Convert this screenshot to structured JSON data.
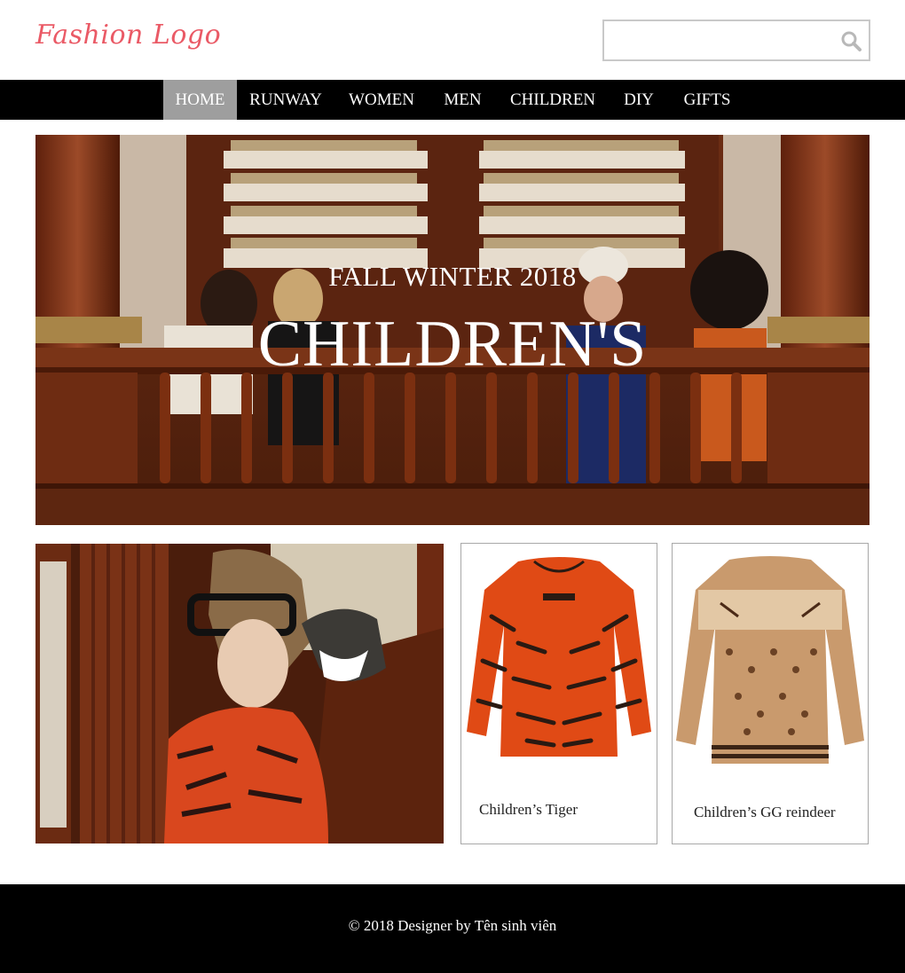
{
  "header": {
    "logo_text": "Fashion Logo",
    "search": {
      "placeholder": "",
      "value": "",
      "icon": "search-icon"
    }
  },
  "nav": {
    "items": [
      {
        "label": "HOME",
        "active": true
      },
      {
        "label": "RUNWAY",
        "active": false
      },
      {
        "label": "WOMEN",
        "active": false
      },
      {
        "label": "MEN",
        "active": false
      },
      {
        "label": "CHILDREN",
        "active": false
      },
      {
        "label": "DIY",
        "active": false
      },
      {
        "label": "GIFTS",
        "active": false
      }
    ]
  },
  "hero": {
    "subtitle": "FALL WINTER 2018",
    "title": "CHILDREN'S"
  },
  "products": [
    {
      "name": "Children’s Tiger"
    },
    {
      "name": "Children’s GG reindeer"
    }
  ],
  "footer": {
    "text": "© 2018 Designer by Tên sinh viên"
  },
  "colors": {
    "logo": "#ea5a66",
    "nav_bg": "#000000",
    "nav_active_bg": "#9e9e9e",
    "footer_bg": "#000000"
  }
}
